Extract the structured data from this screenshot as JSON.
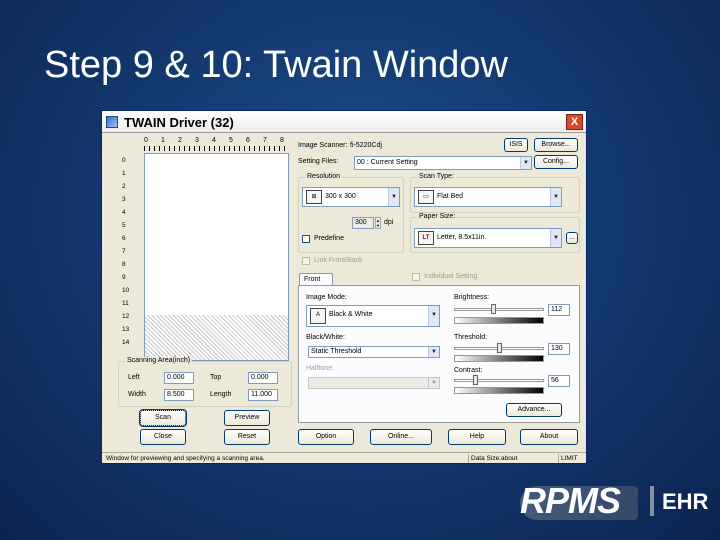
{
  "slide": {
    "title": "Step 9 & 10: Twain Window"
  },
  "window": {
    "title": "TWAIN Driver (32)",
    "close": "X"
  },
  "preview": {
    "ruler_top": [
      "0",
      "1",
      "2",
      "3",
      "4",
      "5",
      "6",
      "7",
      "8"
    ],
    "ruler_left": [
      "0",
      "1",
      "2",
      "3",
      "4",
      "5",
      "6",
      "7",
      "8",
      "9",
      "10",
      "11",
      "12",
      "13",
      "14"
    ]
  },
  "scan_area": {
    "title": "Scanning Area(inch)",
    "left_label": "Left",
    "left_value": "0.000",
    "top_label": "Top",
    "top_value": "0.000",
    "width_label": "Width",
    "width_value": "8.500",
    "length_label": "Length",
    "length_value": "11.000"
  },
  "buttons": {
    "scan": "Scan",
    "preview": "Preview",
    "close": "Close",
    "reset": "Reset",
    "option": "Option",
    "online": "Online...",
    "help": "Help",
    "about": "About",
    "browse": "Browse...",
    "config": "Config...",
    "advance": "Advance...",
    "more": "..."
  },
  "scanner": {
    "label": "Image Scanner:",
    "value": "fi-5220Cdj",
    "badge": "ISIS"
  },
  "setting_files": {
    "label": "Setting Files:",
    "value": "00 : Current Setting"
  },
  "resolution": {
    "title": "Resolution",
    "value": "300 x 300",
    "custom_value": "300",
    "unit": "dpi",
    "predefine": "Predefine"
  },
  "scan_type": {
    "title": "Scan Type:",
    "value": "Flat Bed"
  },
  "paper_size": {
    "title": "Paper Size:",
    "value": "Letter, 8.5x11in.",
    "icon": "LT"
  },
  "options": {
    "link_front_back": "Link Front/Back",
    "individual_setting": "Individual Setting"
  },
  "tabs": {
    "front": "Front"
  },
  "image_mode": {
    "label": "Image Mode:",
    "value": "Black & White"
  },
  "black_white": {
    "label": "Black/White:",
    "value": "Static Threshold"
  },
  "halftone": {
    "label": "Halftone:",
    "value": ""
  },
  "brightness": {
    "label": "Brightness:",
    "value": "112",
    "level": 0.44
  },
  "threshold": {
    "label": "Threshold:",
    "value": "130",
    "level": 0.51
  },
  "contrast": {
    "label": "Contrast:",
    "value": "56",
    "level": 0.22
  },
  "status": {
    "message": "Window for previewing and specifying a scanning area.",
    "data_size": "Data Size:about",
    "unit": "LIMIT"
  },
  "logo": {
    "brand": "RPMS",
    "suffix": "EHR"
  }
}
